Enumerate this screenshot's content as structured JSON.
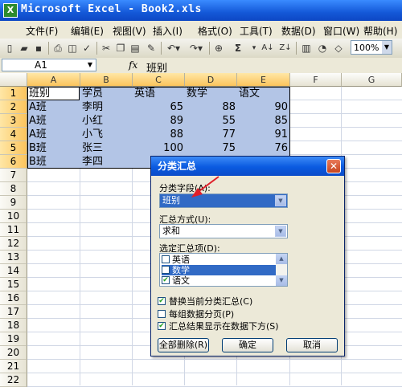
{
  "window": {
    "title": "Microsoft Excel - Book2.xls"
  },
  "menubar": [
    {
      "label": "文件(F)"
    },
    {
      "label": "编辑(E)"
    },
    {
      "label": "视图(V)"
    },
    {
      "label": "插入(I)"
    },
    {
      "label": "格式(O)"
    },
    {
      "label": "工具(T)"
    },
    {
      "label": "数据(D)"
    },
    {
      "label": "窗口(W)"
    },
    {
      "label": "帮助(H)"
    }
  ],
  "toolbar": {
    "zoom": "100%",
    "sigma": "Σ"
  },
  "formula_bar": {
    "name_box": "A1",
    "fx": "fx",
    "value": "班别"
  },
  "columns": [
    "A",
    "B",
    "C",
    "D",
    "E",
    "F",
    "G"
  ],
  "rows": [
    "1",
    "2",
    "3",
    "4",
    "5",
    "6",
    "7",
    "8",
    "9",
    "10",
    "11",
    "12",
    "13",
    "14",
    "15",
    "16",
    "17",
    "18",
    "19",
    "20",
    "21",
    "22"
  ],
  "sheet": {
    "header": [
      "班别",
      "学员",
      "英语",
      "数学",
      "语文"
    ],
    "records": [
      [
        "A班",
        "李明",
        "65",
        "88",
        "90"
      ],
      [
        "A班",
        "小红",
        "89",
        "55",
        "85"
      ],
      [
        "A班",
        "小飞",
        "88",
        "77",
        "91"
      ],
      [
        "B班",
        "张三",
        "100",
        "75",
        "76"
      ],
      [
        "B班",
        "李四",
        "",
        "",
        ""
      ]
    ]
  },
  "dialog": {
    "title": "分类汇总",
    "group_by_label": "分类字段(A):",
    "group_by_value": "班别",
    "function_label": "汇总方式(U):",
    "function_value": "求和",
    "items_label": "选定汇总项(D):",
    "items": [
      {
        "label": "英语",
        "checked": false
      },
      {
        "label": "数学",
        "checked": false
      },
      {
        "label": "语文",
        "checked": true
      }
    ],
    "options": [
      {
        "label": "替换当前分类汇总(C)",
        "checked": true
      },
      {
        "label": "每组数据分页(P)",
        "checked": false
      },
      {
        "label": "汇总结果显示在数据下方(S)",
        "checked": true
      }
    ],
    "buttons": {
      "remove_all": "全部删除(R)",
      "ok": "确定",
      "cancel": "取消"
    }
  },
  "colors": {
    "title_bar": "#0d47c4",
    "selection": "#b3c5e6",
    "highlight": "#316ac5",
    "arrow": "#e0202a"
  }
}
